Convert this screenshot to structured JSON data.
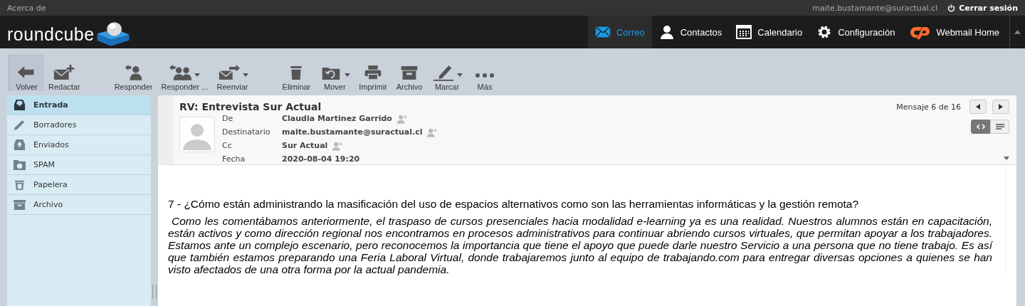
{
  "topbar": {
    "about": "Acerca de",
    "user": "maite.bustamante@suractual.cl",
    "logout": "Cerrar sesión"
  },
  "logo": "roundcube",
  "nav": [
    {
      "label": "Correo",
      "selected": true
    },
    {
      "label": "Contactos",
      "selected": false
    },
    {
      "label": "Calendario",
      "selected": false
    },
    {
      "label": "Configuración",
      "selected": false
    },
    {
      "label": "Webmail Home",
      "selected": false
    }
  ],
  "toolbar": [
    {
      "label": "Volver",
      "has_menu": false
    },
    {
      "label": "Redactar",
      "has_menu": false
    },
    {
      "label": "Responder",
      "has_menu": false
    },
    {
      "label": "Responder ...",
      "has_menu": true
    },
    {
      "label": "Reenviar",
      "has_menu": true
    },
    {
      "label": "Eliminar",
      "has_menu": false
    },
    {
      "label": "Mover",
      "has_menu": true
    },
    {
      "label": "Imprimir",
      "has_menu": false
    },
    {
      "label": "Archivo",
      "has_menu": false
    },
    {
      "label": "Marcar",
      "has_menu": true
    },
    {
      "label": "Más",
      "has_menu": false
    }
  ],
  "folders": [
    {
      "label": "Entrada",
      "selected": true
    },
    {
      "label": "Borradores",
      "selected": false
    },
    {
      "label": "Enviados",
      "selected": false
    },
    {
      "label": "SPAM",
      "selected": false
    },
    {
      "label": "Papelera",
      "selected": false
    },
    {
      "label": "Archivo",
      "selected": false
    }
  ],
  "message": {
    "subject": "RV: Entrevista Sur Actual",
    "counter": "Mensaje 6 de 16",
    "headers": [
      {
        "label": "De",
        "value": "Claudia Martinez Garrido",
        "add_contact": true
      },
      {
        "label": "Destinatario",
        "value": "maite.bustamante@suractual.cl",
        "add_contact": true
      },
      {
        "label": "Cc",
        "value": "Sur Actual",
        "add_contact": true
      },
      {
        "label": "Fecha",
        "value": "2020-08-04 19:20",
        "add_contact": false
      }
    ],
    "views": [
      {
        "kind": "html",
        "selected": true
      },
      {
        "kind": "plain",
        "selected": false
      }
    ],
    "question": "7 - ¿Cómo están administrando la masificación del uso de espacios alternativos como son las herramientas informáticas y la gestión remota?",
    "answer": "Como les comentábamos anteriormente, el traspaso de cursos presenciales hacia modalidad e-learning ya es una realidad. Nuestros alumnos están en capacitación, están activos y como dirección regional nos encontramos en procesos administrativos para continuar abriendo cursos virtuales, que permitan apoyar a los trabajadores. Estamos ante un complejo escenario, pero reconocemos la importancia que tiene el apoyo que puede darle nuestro Servicio a una persona que no tiene trabajo. Es así que también estamos preparando una Feria Laboral Virtual, donde trabajaremos junto al equipo de trabajando.com para entregar diversas opciones a quienes se han visto afectados de una otra forma por la actual pandemia."
  }
}
